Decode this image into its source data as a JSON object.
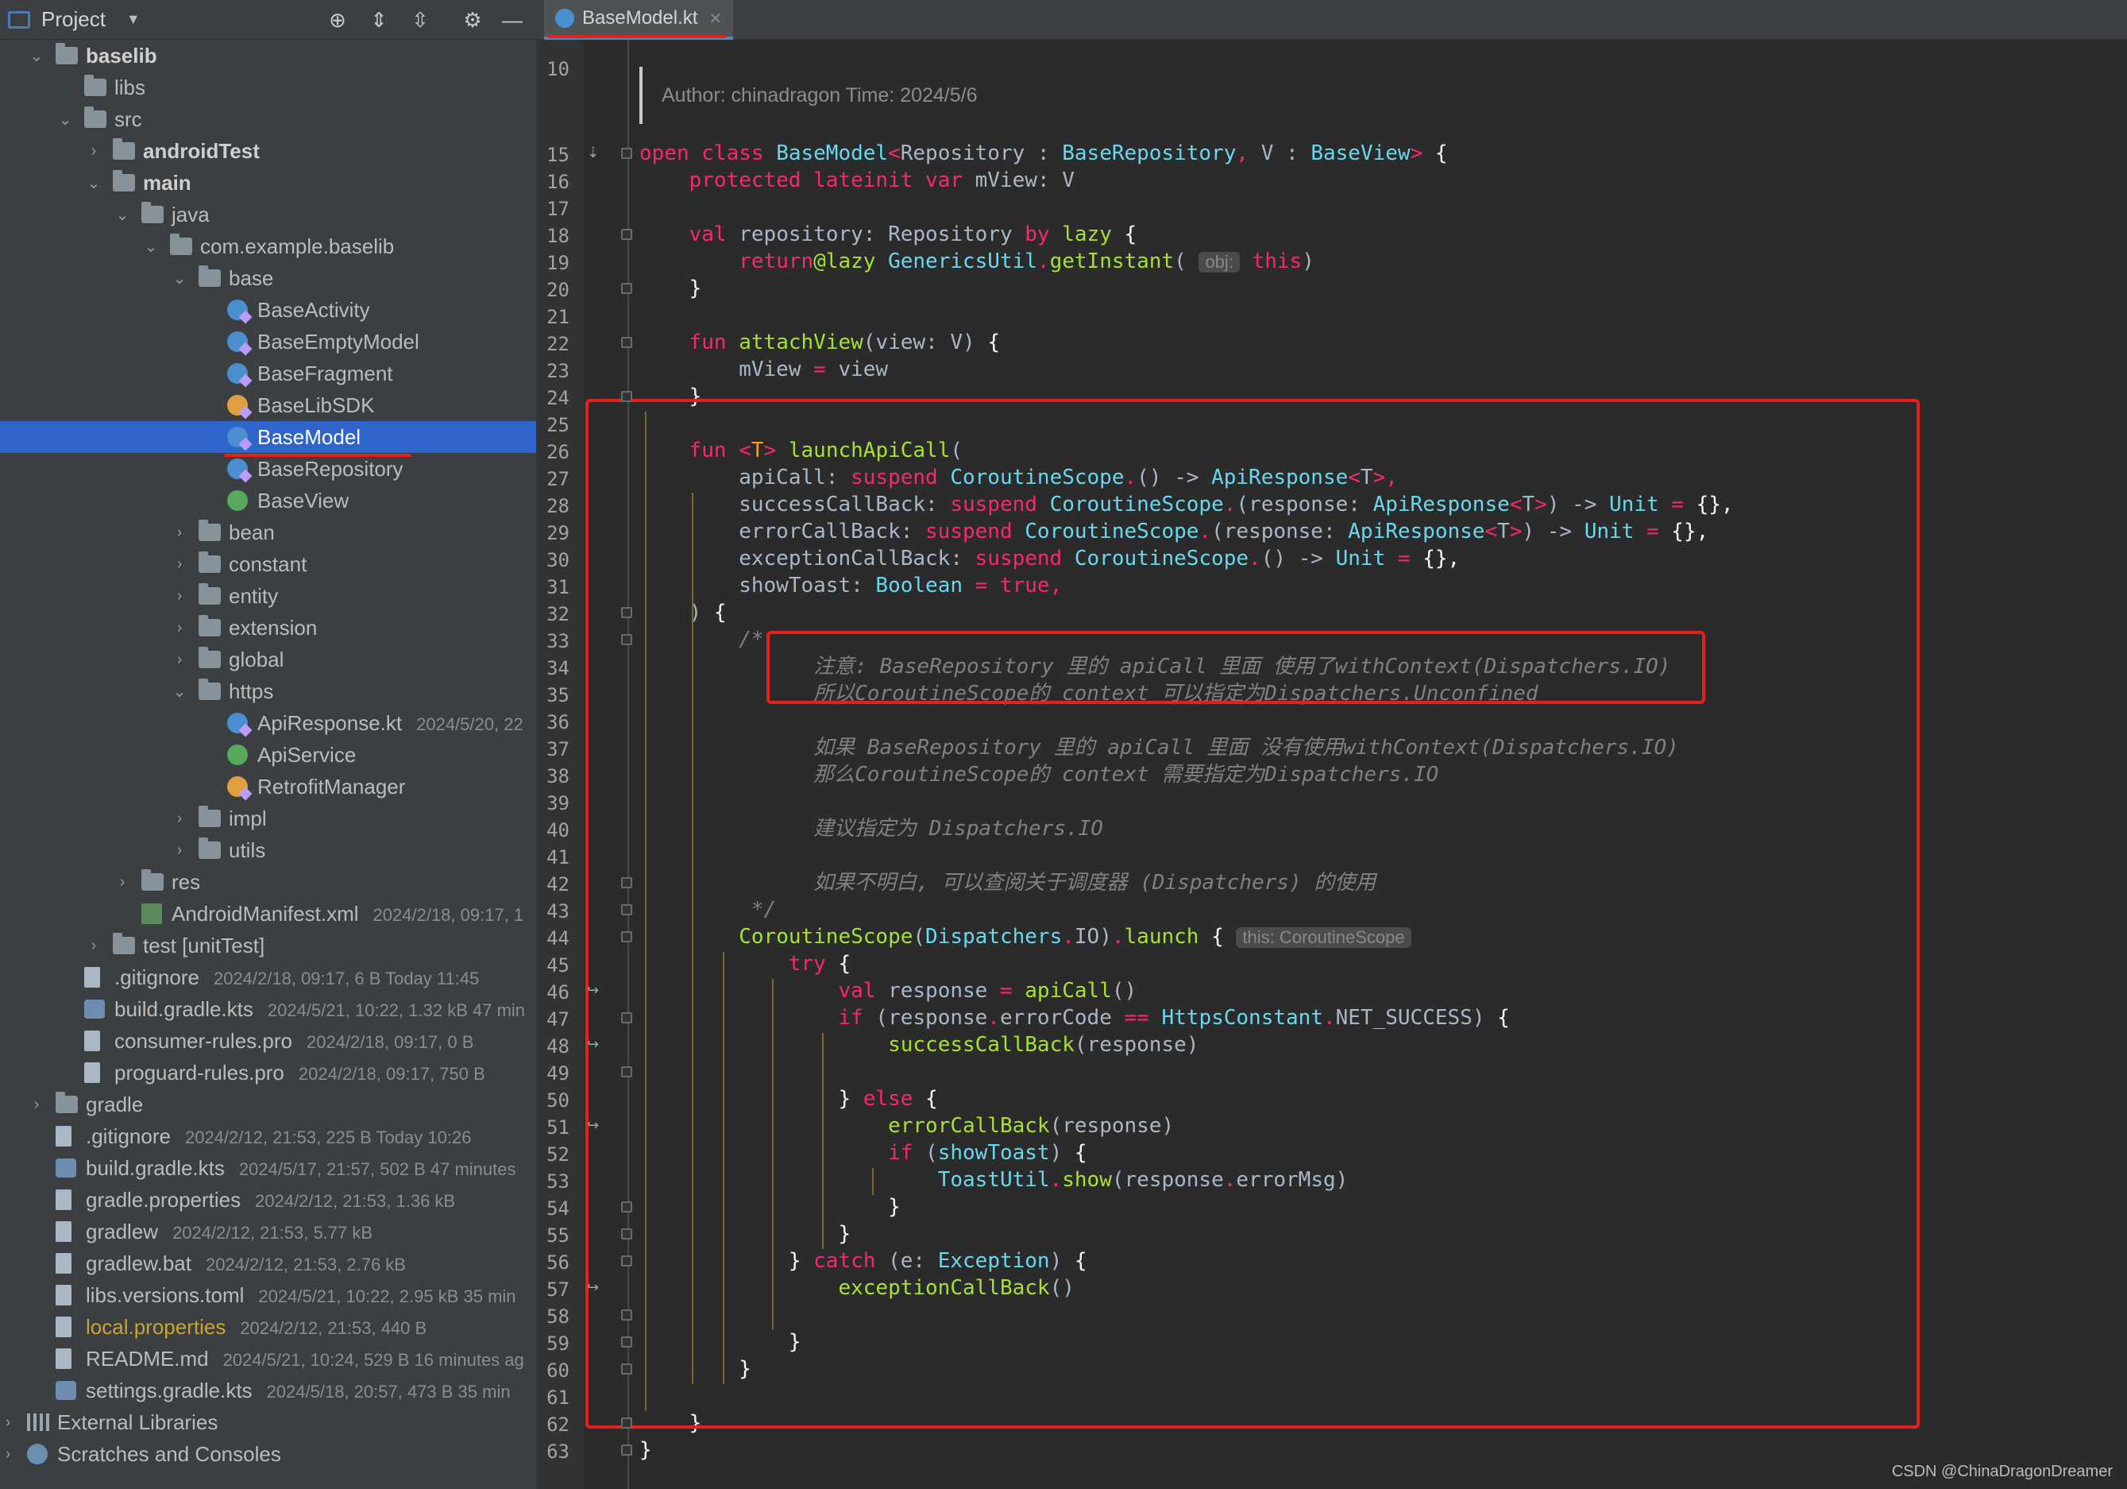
{
  "project_panel": {
    "title": "Project",
    "tree": [
      {
        "label": "baselib",
        "meta": ""
      },
      {
        "label": "libs",
        "meta": ""
      },
      {
        "label": "src",
        "meta": ""
      },
      {
        "label": "androidTest",
        "meta": ""
      },
      {
        "label": "main",
        "meta": ""
      },
      {
        "label": "java",
        "meta": ""
      },
      {
        "label": "com.example.baselib",
        "meta": ""
      },
      {
        "label": "base",
        "meta": ""
      },
      {
        "label": "BaseActivity",
        "meta": ""
      },
      {
        "label": "BaseEmptyModel",
        "meta": ""
      },
      {
        "label": "BaseFragment",
        "meta": ""
      },
      {
        "label": "BaseLibSDK",
        "meta": ""
      },
      {
        "label": "BaseModel",
        "meta": ""
      },
      {
        "label": "BaseRepository",
        "meta": ""
      },
      {
        "label": "BaseView",
        "meta": ""
      },
      {
        "label": "bean",
        "meta": ""
      },
      {
        "label": "constant",
        "meta": ""
      },
      {
        "label": "entity",
        "meta": ""
      },
      {
        "label": "extension",
        "meta": ""
      },
      {
        "label": "global",
        "meta": ""
      },
      {
        "label": "https",
        "meta": ""
      },
      {
        "label": "ApiResponse.kt",
        "meta": "2024/5/20, 22"
      },
      {
        "label": "ApiService",
        "meta": ""
      },
      {
        "label": "RetrofitManager",
        "meta": ""
      },
      {
        "label": "impl",
        "meta": ""
      },
      {
        "label": "utils",
        "meta": ""
      },
      {
        "label": "res",
        "meta": ""
      },
      {
        "label": "AndroidManifest.xml",
        "meta": "2024/2/18, 09:17, 1"
      },
      {
        "label": "test [unitTest]",
        "meta": ""
      },
      {
        "label": ".gitignore",
        "meta": "2024/2/18, 09:17, 6 B Today 11:45"
      },
      {
        "label": "build.gradle.kts",
        "meta": "2024/5/21, 10:22, 1.32 kB 47 min"
      },
      {
        "label": "consumer-rules.pro",
        "meta": "2024/2/18, 09:17, 0 B"
      },
      {
        "label": "proguard-rules.pro",
        "meta": "2024/2/18, 09:17, 750 B"
      },
      {
        "label": "gradle",
        "meta": ""
      },
      {
        "label": ".gitignore",
        "meta": "2024/2/12, 21:53, 225 B Today 10:26"
      },
      {
        "label": "build.gradle.kts",
        "meta": "2024/5/17, 21:57, 502 B 47 minutes"
      },
      {
        "label": "gradle.properties",
        "meta": "2024/2/12, 21:53, 1.36 kB"
      },
      {
        "label": "gradlew",
        "meta": "2024/2/12, 21:53, 5.77 kB"
      },
      {
        "label": "gradlew.bat",
        "meta": "2024/2/12, 21:53, 2.76 kB"
      },
      {
        "label": "libs.versions.toml",
        "meta": "2024/5/21, 10:22, 2.95 kB 35 min"
      },
      {
        "label": "local.properties",
        "meta": "2024/2/12, 21:53, 440 B"
      },
      {
        "label": "README.md",
        "meta": "2024/5/21, 10:24, 529 B 16 minutes ag"
      },
      {
        "label": "settings.gradle.kts",
        "meta": "2024/5/18, 20:57, 473 B 35 min"
      },
      {
        "label": "External Libraries",
        "meta": ""
      },
      {
        "label": "Scratches and Consoles",
        "meta": ""
      }
    ]
  },
  "editor": {
    "tab_label": "BaseModel.kt",
    "doc_comment": "Author: chinadragon Time: 2024/5/6",
    "line_numbers": [
      "10",
      "15",
      "16",
      "17",
      "18",
      "19",
      "20",
      "21",
      "22",
      "23",
      "24",
      "25",
      "26",
      "27",
      "28",
      "29",
      "30",
      "31",
      "32",
      "33",
      "34",
      "35",
      "36",
      "37",
      "38",
      "39",
      "40",
      "41",
      "42",
      "43",
      "44",
      "45",
      "46",
      "47",
      "48",
      "49",
      "50",
      "51",
      "52",
      "53",
      "54",
      "55",
      "56",
      "57",
      "58",
      "59",
      "60",
      "61",
      "62",
      "63"
    ],
    "hints": {
      "obj": "obj:",
      "this_scope": "this: CoroutineScope"
    }
  },
  "watermark": "CSDN @ChinaDragonDreamer",
  "colors": {
    "selection": "#2f65ca",
    "highlight_box": "#e8201c",
    "keyword": "#f92672",
    "type": "#66d9ef",
    "function": "#a6e22e"
  }
}
